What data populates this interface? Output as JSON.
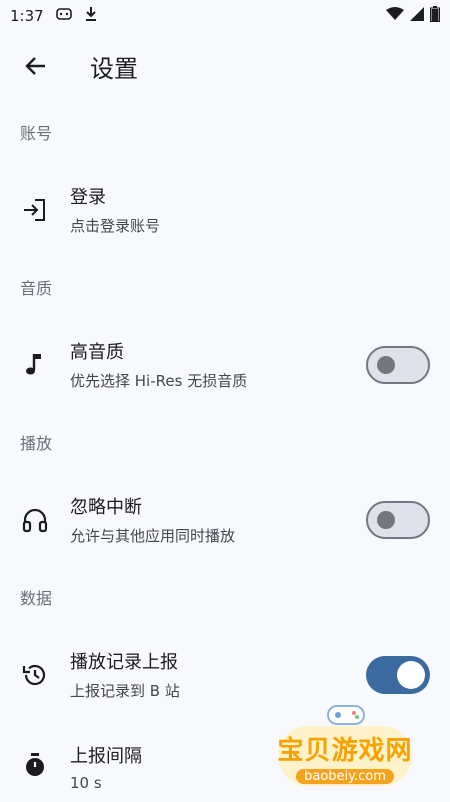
{
  "status_bar": {
    "time": "1:37"
  },
  "header": {
    "title": "设置"
  },
  "sections": {
    "account": {
      "header": "账号",
      "login": {
        "title": "登录",
        "subtitle": "点击登录账号",
        "icon": "login-icon"
      }
    },
    "quality": {
      "header": "音质",
      "hq": {
        "title": "高音质",
        "subtitle": "优先选择 Hi-Res 无损音质",
        "icon": "music-note-icon",
        "switch_on": false
      }
    },
    "playback": {
      "header": "播放",
      "ignore": {
        "title": "忽略中断",
        "subtitle": "允许与其他应用同时播放",
        "icon": "headphones-icon",
        "switch_on": false
      }
    },
    "data": {
      "header": "数据",
      "report": {
        "title": "播放记录上报",
        "subtitle": "上报记录到 B 站",
        "icon": "history-icon",
        "switch_on": true
      },
      "interval": {
        "title": "上报间隔",
        "subtitle": "10 s",
        "icon": "timer-icon"
      }
    }
  },
  "watermark": {
    "title": "宝贝游戏网",
    "url": "baobeiy.com"
  },
  "colors": {
    "accent": "#3b6aa0",
    "background": "#f8f9fd"
  }
}
